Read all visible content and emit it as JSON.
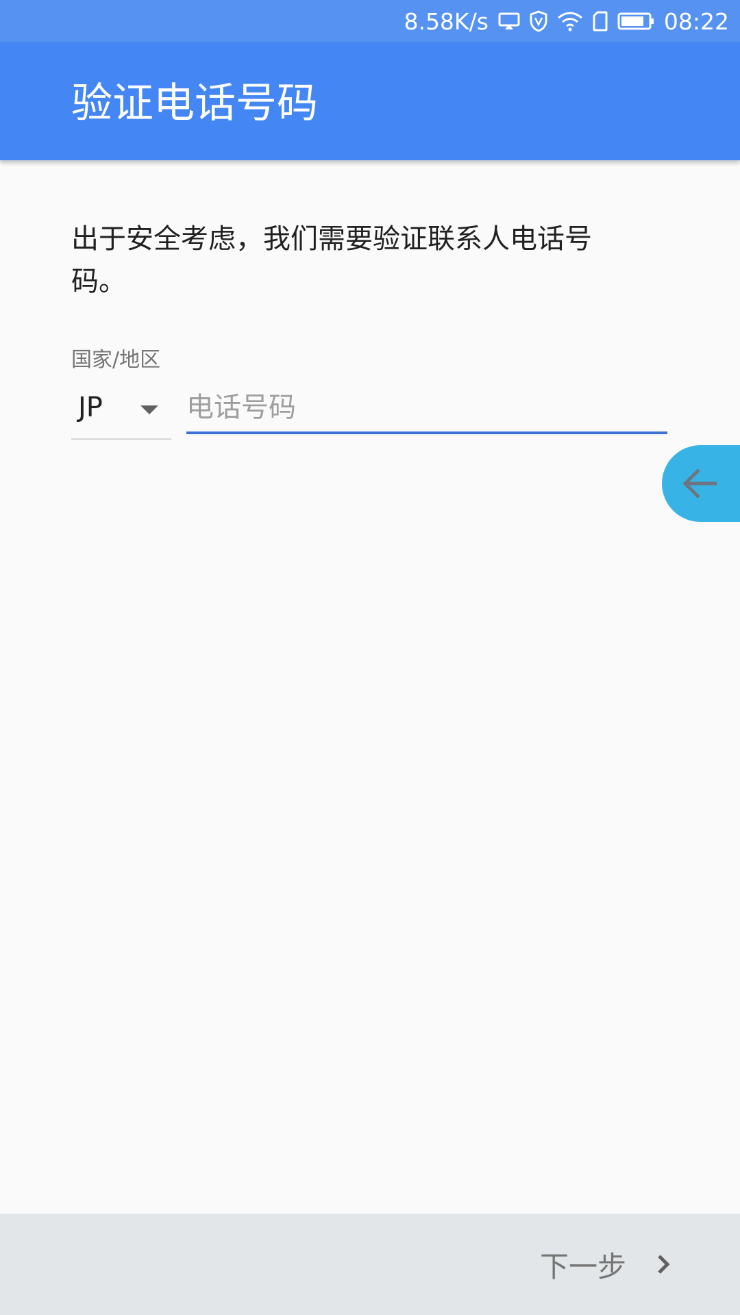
{
  "status_bar": {
    "network_speed": "8.58K/s",
    "time": "08:22",
    "icons": [
      "cast-icon",
      "vpn-shield-icon",
      "wifi-icon",
      "sim-card-icon",
      "battery-icon"
    ]
  },
  "app_bar": {
    "title": "验证电话号码"
  },
  "main": {
    "description": "出于安全考虑，我们需要验证联系人电话号码。",
    "country_label": "国家/地区",
    "country_value": "JP",
    "phone_placeholder": "电话号码",
    "phone_value": ""
  },
  "floating": {
    "back_icon": "arrow-left-icon"
  },
  "bottom_bar": {
    "next_label": "下一步",
    "next_icon": "chevron-right-icon"
  },
  "colors": {
    "status_bar": "#5592f2",
    "app_bar": "#4487f4",
    "input_underline": "#3c73d6",
    "fab": "#37b3e6",
    "bottom_bar": "#e3e6e9"
  }
}
